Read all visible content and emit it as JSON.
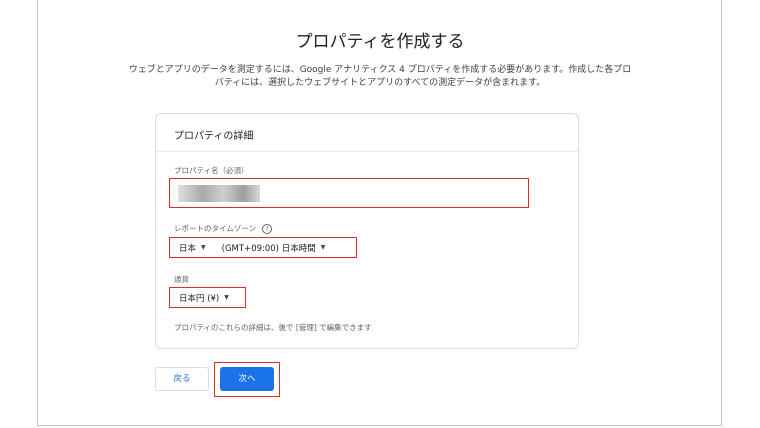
{
  "page": {
    "title": "プロパティを作成する",
    "description_line1": "ウェブとアプリのデータを測定するには、Google アナリティクス 4 プロパティを作成する必要があります。作成した各プロ",
    "description_line2": "パティには、選択したウェブサイトとアプリのすべての測定データが含まれます。"
  },
  "card": {
    "header": "プロパティの詳細",
    "property_name": {
      "label": "プロパティ名（必須）",
      "value": ""
    },
    "timezone": {
      "label": "レポートのタイムゾーン",
      "help_icon": "help-circle-icon",
      "country": "日本",
      "zone": "(GMT+09:00) 日本時間"
    },
    "currency": {
      "label": "通貨",
      "value": "日本円 (¥)"
    },
    "note": "プロパティのこれらの詳細は、後で [管理] で編集できます"
  },
  "buttons": {
    "back": "戻る",
    "next": "次へ"
  },
  "colors": {
    "primary": "#1a73e8",
    "highlight": "#d93025",
    "border": "#dadce0"
  }
}
